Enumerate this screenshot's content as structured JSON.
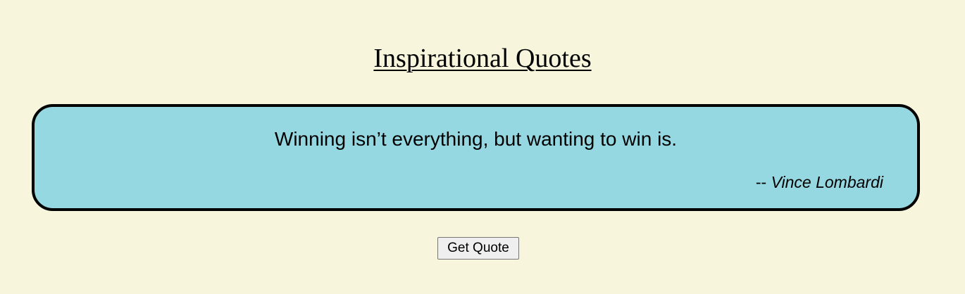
{
  "page": {
    "title": "Inspirational Quotes"
  },
  "quote": {
    "text": "Winning isn’t everything, but wanting to win is.",
    "author_prefix": "--",
    "author": "Vince Lombardi"
  },
  "actions": {
    "get_quote_label": "Get Quote"
  },
  "colors": {
    "background": "#f7f6dc",
    "quote_box": "#96d8e1",
    "border": "#000000"
  }
}
